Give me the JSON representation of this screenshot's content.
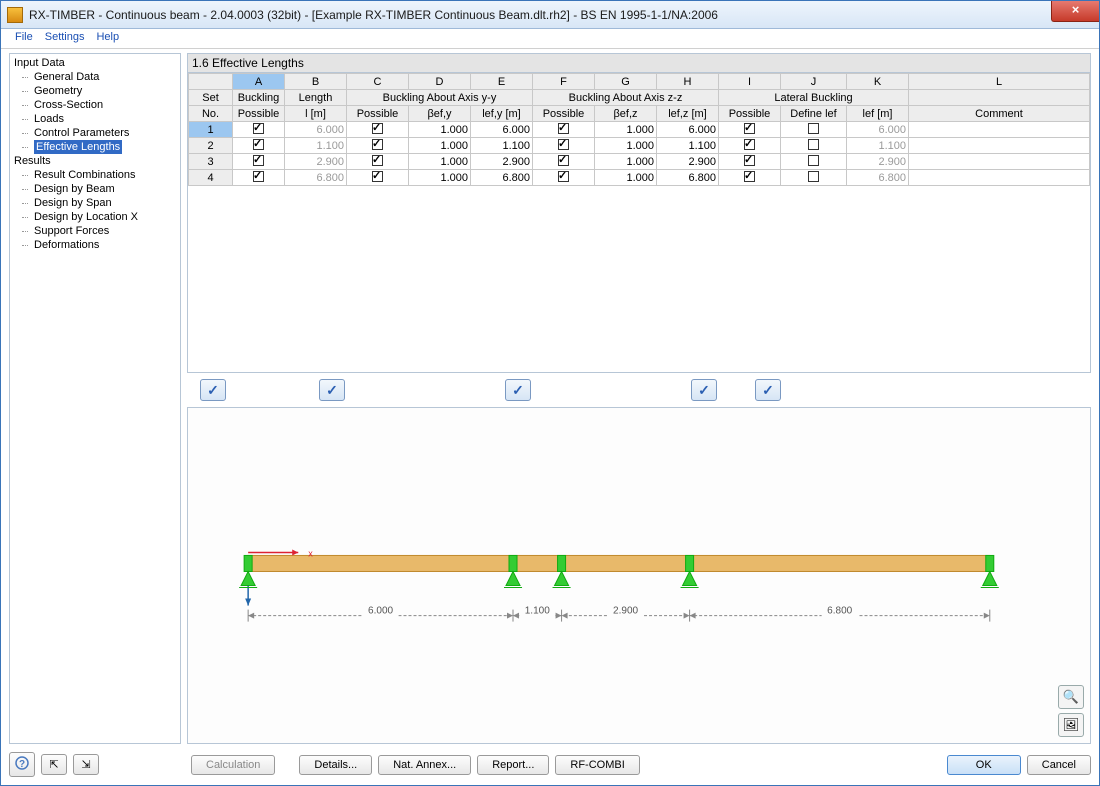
{
  "window": {
    "title": "RX-TIMBER - Continuous beam - 2.04.0003 (32bit) - [Example RX-TIMBER Continuous Beam.dlt.rh2] - BS EN 1995-1-1/NA:2006"
  },
  "menu": {
    "file": "File",
    "settings": "Settings",
    "help": "Help"
  },
  "sidebar": {
    "input_header": "Input Data",
    "input_items": [
      "General Data",
      "Geometry",
      "Cross-Section",
      "Loads",
      "Control Parameters",
      "Effective Lengths"
    ],
    "selected_index": 5,
    "results_header": "Results",
    "results_items": [
      "Result Combinations",
      "Design by Beam",
      "Design by Span",
      "Design by Location X",
      "Support Forces",
      "Deformations"
    ]
  },
  "panel": {
    "title": "1.6 Effective Lengths"
  },
  "grid": {
    "letters": [
      "A",
      "B",
      "C",
      "D",
      "E",
      "F",
      "G",
      "H",
      "I",
      "J",
      "K",
      "L"
    ],
    "header1": {
      "set": "Set",
      "buckling": "Buckling",
      "length": "Length",
      "axis_yy": "Buckling About Axis y-y",
      "axis_zz": "Buckling About Axis z-z",
      "lateral": "Lateral Buckling"
    },
    "header2": {
      "no": "No.",
      "possible": "Possible",
      "l_m": "l [m]",
      "possible_y": "Possible",
      "beta_y": "βef,y",
      "ly": "lef,y [m]",
      "possible_z": "Possible",
      "beta_z": "βef,z",
      "lz": "lef,z [m]",
      "possible_l": "Possible",
      "define_l": "Define lef",
      "lef": "lef [m]",
      "comment": "Comment"
    },
    "rows": [
      {
        "no": "1",
        "buck": true,
        "l": "6.000",
        "py": true,
        "by": "1.000",
        "ly": "6.000",
        "pz": true,
        "bz": "1.000",
        "lz": "6.000",
        "pl": true,
        "dl": false,
        "lef": "6.000",
        "c": ""
      },
      {
        "no": "2",
        "buck": true,
        "l": "1.100",
        "py": true,
        "by": "1.000",
        "ly": "1.100",
        "pz": true,
        "bz": "1.000",
        "lz": "1.100",
        "pl": true,
        "dl": false,
        "lef": "1.100",
        "c": ""
      },
      {
        "no": "3",
        "buck": true,
        "l": "2.900",
        "py": true,
        "by": "1.000",
        "ly": "2.900",
        "pz": true,
        "bz": "1.000",
        "lz": "2.900",
        "pl": true,
        "dl": false,
        "lef": "2.900",
        "c": ""
      },
      {
        "no": "4",
        "buck": true,
        "l": "6.800",
        "py": true,
        "by": "1.000",
        "ly": "6.800",
        "pz": true,
        "bz": "1.000",
        "lz": "6.800",
        "pl": true,
        "dl": false,
        "lef": "6.800",
        "c": ""
      }
    ]
  },
  "beam": {
    "spans": [
      "6.000",
      "1.100",
      "2.900",
      "6.800"
    ]
  },
  "buttons": {
    "calculation": "Calculation",
    "details": "Details...",
    "nat_annex": "Nat. Annex...",
    "report": "Report...",
    "rf_combi": "RF-COMBI",
    "ok": "OK",
    "cancel": "Cancel",
    "help": "?",
    "load1": "⎘",
    "load2": "⎗"
  }
}
